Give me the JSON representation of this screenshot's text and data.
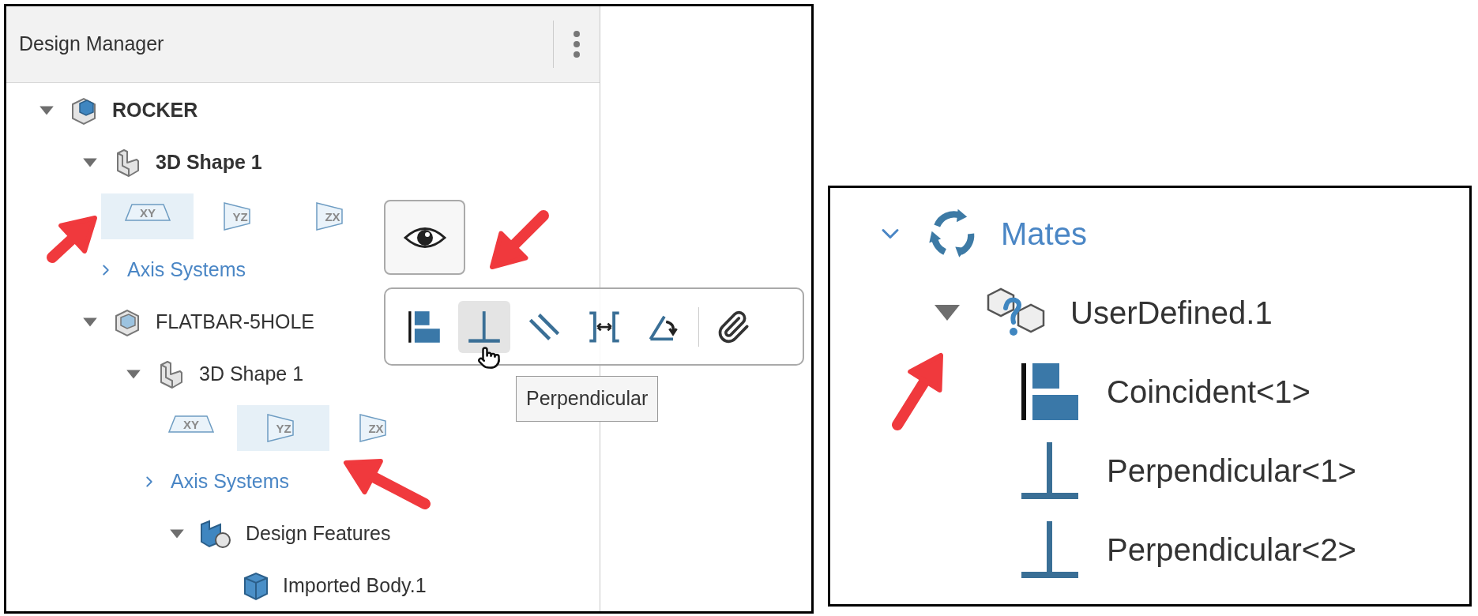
{
  "design_manager": {
    "title": "Design Manager",
    "tree": [
      {
        "kind": "assembly",
        "label": "ROCKER",
        "active": true,
        "expanded": true,
        "children": [
          {
            "kind": "shape",
            "label": "3D Shape 1",
            "active": true,
            "expanded": true,
            "children": [
              {
                "kind": "planes",
                "planes": [
                  {
                    "label": "XY",
                    "selected": true
                  },
                  {
                    "label": "YZ",
                    "selected": false
                  },
                  {
                    "label": "ZX",
                    "selected": false
                  }
                ]
              },
              {
                "kind": "folder",
                "label": "Axis Systems",
                "expanded": false
              }
            ]
          },
          {
            "kind": "part",
            "label": "FLATBAR-5HOLE",
            "active": false,
            "expanded": true,
            "children": [
              {
                "kind": "shape",
                "label": "3D Shape 1",
                "active": false,
                "expanded": true,
                "children": [
                  {
                    "kind": "planes",
                    "planes": [
                      {
                        "label": "XY",
                        "selected": false
                      },
                      {
                        "label": "YZ",
                        "selected": true
                      },
                      {
                        "label": "ZX",
                        "selected": false
                      }
                    ]
                  },
                  {
                    "kind": "folder",
                    "label": "Axis Systems",
                    "expanded": false
                  },
                  {
                    "kind": "features",
                    "label": "Design Features",
                    "active": false,
                    "expanded": true,
                    "children": [
                      {
                        "kind": "body",
                        "label": "Imported Body.1"
                      }
                    ]
                  }
                ]
              }
            ]
          }
        ]
      }
    ]
  },
  "mate_toolbar": {
    "tools": [
      {
        "kind": "coincident",
        "hovered": false
      },
      {
        "kind": "perpendicular",
        "hovered": true
      },
      {
        "kind": "parallel",
        "hovered": false
      },
      {
        "kind": "distance",
        "hovered": false
      },
      {
        "kind": "angle",
        "hovered": false
      },
      {
        "kind": "attach",
        "hovered": false
      }
    ],
    "tooltip": "Perpendicular"
  },
  "mates_panel": {
    "title": "Mates",
    "expanded": true,
    "items": [
      {
        "label": "UserDefined.1",
        "expanded": true,
        "children": [
          {
            "kind": "coincident",
            "label": "Coincident<1>"
          },
          {
            "kind": "perpendicular",
            "label": "Perpendicular<1>"
          },
          {
            "kind": "perpendicular",
            "label": "Perpendicular<2>"
          }
        ]
      }
    ]
  }
}
